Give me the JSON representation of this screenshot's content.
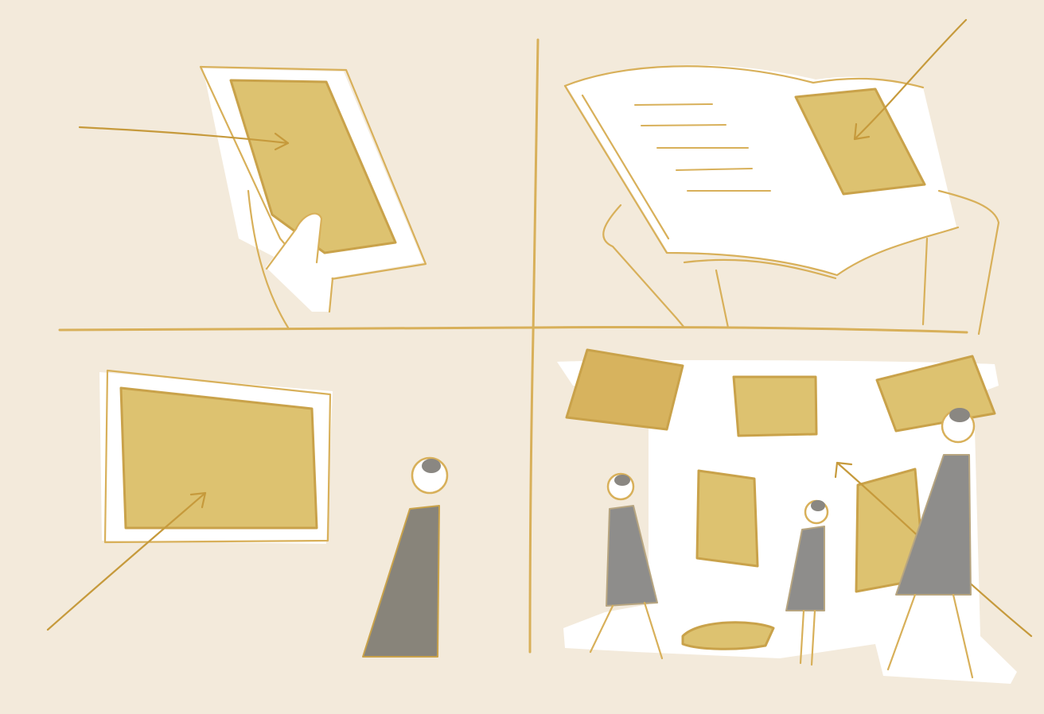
{
  "illustration": {
    "panels": [
      {
        "id": "tablet",
        "subject": "tablet-held-in-hand"
      },
      {
        "id": "book",
        "subject": "open-book-with-picture"
      },
      {
        "id": "wall-screen",
        "subject": "framed-screen-with-viewer"
      },
      {
        "id": "gallery",
        "subject": "immersive-room-with-visitors"
      }
    ]
  },
  "colors": {
    "background": "#f3eadb",
    "pencil": "#d8b05a",
    "screen_fill": "#ddc270",
    "figure_grey": "#88847a",
    "paper": "#ffffff"
  }
}
